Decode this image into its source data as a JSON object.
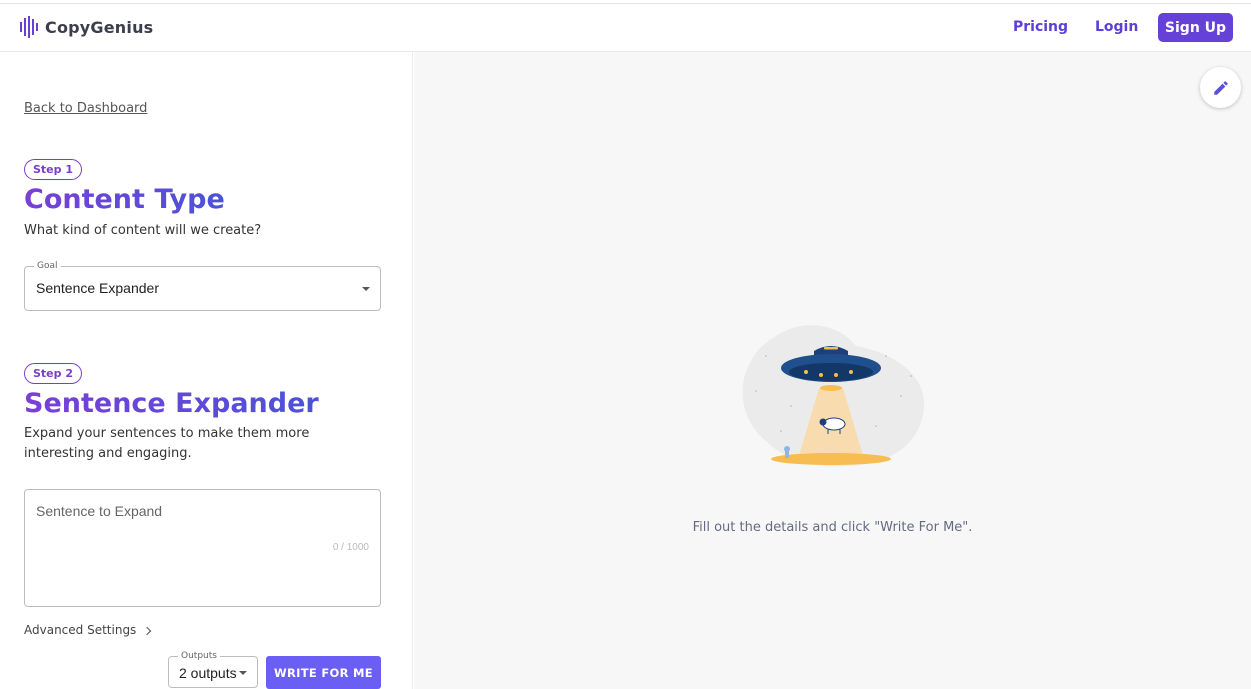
{
  "brand": {
    "name": "CopyGenius",
    "color": "#6541d8"
  },
  "nav": {
    "pricing": "Pricing",
    "login": "Login",
    "signup": "Sign Up"
  },
  "left": {
    "back_link": "Back to Dashboard",
    "step1": {
      "badge": "Step 1",
      "title": "Content Type",
      "subtitle": "What kind of content will we create?",
      "goal_label": "Goal",
      "goal_value": "Sentence Expander"
    },
    "step2": {
      "badge": "Step 2",
      "title": "Sentence Expander",
      "subtitle": "Expand your sentences to make them more interesting and engaging.",
      "input_placeholder": "Sentence to Expand",
      "char_count": "0 / 1000"
    },
    "advanced_settings": "Advanced Settings",
    "outputs_label": "Outputs",
    "outputs_value": "2 outputs",
    "write_button": "WRITE FOR ME"
  },
  "right": {
    "empty_message": "Fill out the details and click \"Write For Me\".",
    "fab_icon": "pencil-icon"
  }
}
